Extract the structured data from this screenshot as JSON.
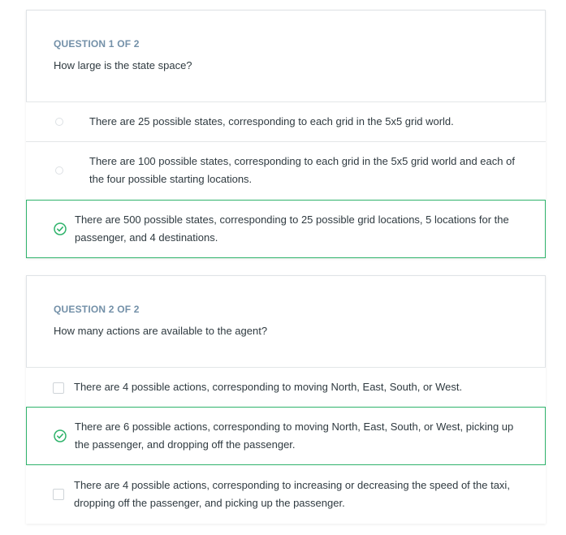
{
  "quiz": {
    "questions": [
      {
        "number": "QUESTION 1 OF 2",
        "text": "How large is the state space?",
        "options": [
          {
            "text": "There are 25 possible states, corresponding to each grid in the 5x5 grid world.",
            "selected": false
          },
          {
            "text": "There are 100 possible states, corresponding to each grid in the 5x5 grid world and each of the four possible starting locations.",
            "selected": false
          },
          {
            "text": "There are 500 possible states, corresponding to 25 possible grid locations, 5 locations for the passenger, and 4 destinations.",
            "selected": true
          }
        ]
      },
      {
        "number": "QUESTION 2 OF 2",
        "text": "How many actions are available to the agent?",
        "options": [
          {
            "text": "There are 4 possible actions, corresponding to moving North, East, South, or West.",
            "selected": false
          },
          {
            "text": "There are 6 possible actions, corresponding to moving North, East, South, or West, picking up the passenger, and dropping off the passenger.",
            "selected": true
          },
          {
            "text": "There are 4 possible actions, corresponding to increasing or decreasing the speed of the taxi, dropping off the passenger, and picking up the passenger.",
            "selected": false
          }
        ]
      }
    ]
  },
  "colors": {
    "correct": "#2fb36b",
    "question_number": "#7390a8",
    "text": "#2f3a40",
    "border": "#dfe3e6"
  },
  "icons": {
    "correct": "check-circle-icon",
    "unselected_single": "radio-icon",
    "unselected_multi": "checkbox-icon"
  }
}
